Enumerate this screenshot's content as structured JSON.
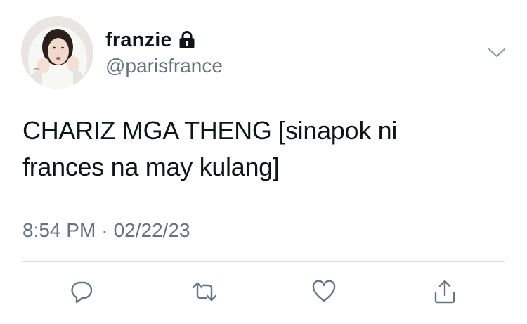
{
  "user": {
    "display_name": "franzie",
    "handle": "@parisfrance",
    "protected_icon": "lock-icon",
    "avatar": "profile-photo"
  },
  "tweet": {
    "text": "CHARIZ MGA THENG [sinapok ni\nfrances na may kulang]",
    "time": "8:54 PM",
    "separator": "·",
    "date": "02/22/23"
  },
  "actions": [
    {
      "name": "reply",
      "icon": "speech-bubble-icon"
    },
    {
      "name": "retweet",
      "icon": "retweet-arrows-icon"
    },
    {
      "name": "like",
      "icon": "heart-icon"
    },
    {
      "name": "share",
      "icon": "share-upload-icon"
    }
  ],
  "colors": {
    "text": "#0f1419",
    "secondary": "#66727d",
    "icon": "#657786",
    "divider": "#d6dce1"
  }
}
